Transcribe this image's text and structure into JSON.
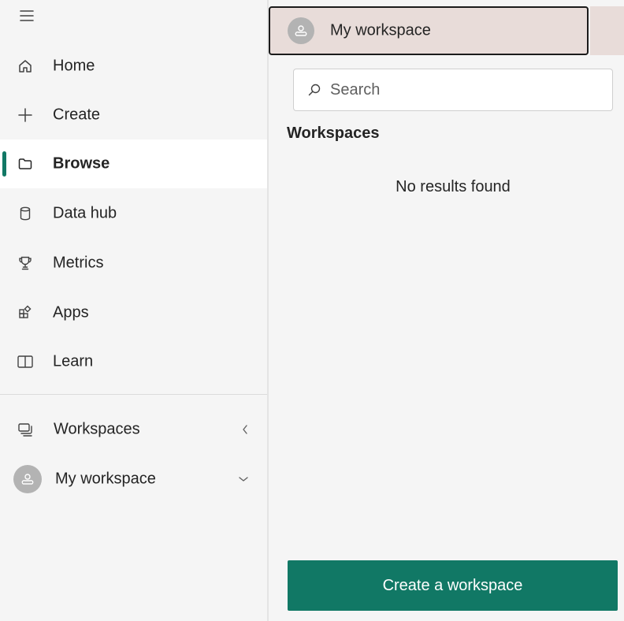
{
  "nav": {
    "items": [
      {
        "label": "Home",
        "icon": "home-icon"
      },
      {
        "label": "Create",
        "icon": "plus-icon"
      },
      {
        "label": "Browse",
        "icon": "folder-icon",
        "active": true
      },
      {
        "label": "Data hub",
        "icon": "database-icon"
      },
      {
        "label": "Metrics",
        "icon": "trophy-icon"
      },
      {
        "label": "Apps",
        "icon": "apps-icon"
      },
      {
        "label": "Learn",
        "icon": "book-icon"
      }
    ],
    "workspaces_label": "Workspaces",
    "my_workspace_label": "My workspace"
  },
  "flyout": {
    "header_label": "My workspace",
    "search_placeholder": "Search",
    "section_title": "Workspaces",
    "empty_text": "No results found",
    "create_button": "Create a workspace"
  },
  "colors": {
    "accent": "#117865",
    "header_bg": "#e8dcd9",
    "nav_bg": "#f5f5f5",
    "active_bg": "#ffffff"
  }
}
